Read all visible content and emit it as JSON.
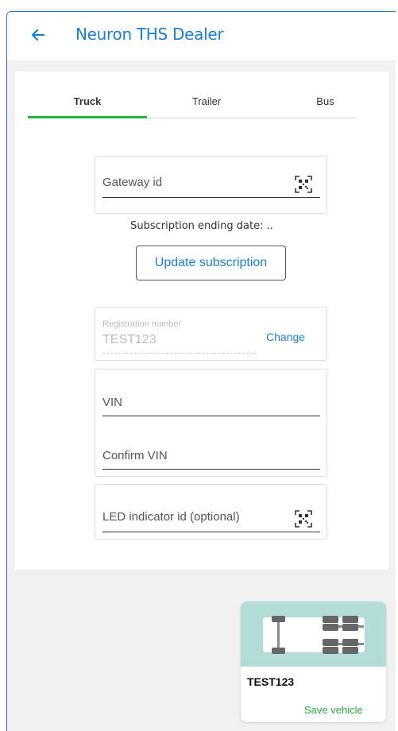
{
  "header": {
    "title": "Neuron THS Dealer",
    "back_icon": "arrow-left-icon"
  },
  "tabs": [
    {
      "label": "Truck",
      "active": true
    },
    {
      "label": "Trailer",
      "active": false
    },
    {
      "label": "Bus",
      "active": false
    }
  ],
  "gateway": {
    "placeholder": "Gateway id",
    "scan_icon": "qr-code-icon"
  },
  "subscription": {
    "ending_text": "Subscription ending date: ..",
    "update_label": "Update subscription"
  },
  "registration": {
    "label": "Registration number",
    "value": "TEST123",
    "change_label": "Change"
  },
  "vin": {
    "vin_placeholder": "VIN",
    "confirm_placeholder": "Confirm VIN"
  },
  "led": {
    "placeholder": "LED indicator id (optional)",
    "scan_icon": "qr-code-icon"
  },
  "vehicle_card": {
    "name": "TEST123",
    "save_label": "Save vehicle",
    "icon": "truck-axles-icon"
  },
  "colors": {
    "accent_blue": "#1a7fd6",
    "accent_green": "#22b342",
    "vehicle_bg": "#b3dcd7"
  }
}
